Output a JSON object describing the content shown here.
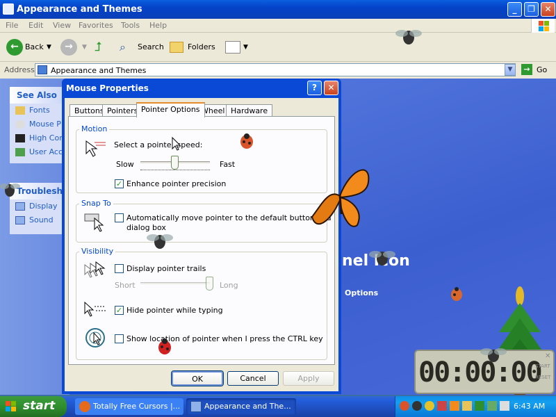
{
  "window": {
    "title": "Appearance and Themes"
  },
  "menu": [
    "File",
    "Edit",
    "View",
    "Favorites",
    "Tools",
    "Help"
  ],
  "toolbar": {
    "back": "Back",
    "search": "Search",
    "folders": "Folders"
  },
  "address": {
    "label": "Address",
    "value": "Appearance and Themes",
    "go": "Go"
  },
  "left": {
    "see_also": {
      "title": "See Also",
      "items": [
        "Fonts",
        "Mouse P",
        "High Con",
        "User Acc"
      ]
    },
    "troubleshoot": {
      "title": "Troublesho",
      "items": [
        "Display",
        "Sound"
      ]
    }
  },
  "content": {
    "big_text": "nel Icon",
    "options_text": "Options"
  },
  "dialog": {
    "title": "Mouse Properties",
    "tabs": [
      "Buttons",
      "Pointers",
      "Pointer Options",
      "Wheel",
      "Hardware"
    ],
    "motion": {
      "label": "Motion",
      "select_speed": "Select a pointer speed:",
      "slow": "Slow",
      "fast": "Fast",
      "enhance": "Enhance pointer precision",
      "enhance_checked": true,
      "speed_level": 0.5
    },
    "snap": {
      "label": "Snap To",
      "text1": "Automatically move pointer to the default button in a",
      "text2": "dialog box",
      "checked": false
    },
    "visibility": {
      "label": "Visibility",
      "trails": "Display pointer trails",
      "short": "Short",
      "long": "Long",
      "trails_checked": false,
      "trail_level": 1.0,
      "hide": "Hide pointer while typing",
      "hide_checked": true,
      "show_loc": "Show location of pointer when I press the CTRL key",
      "show_checked": false
    },
    "buttons": {
      "ok": "OK",
      "cancel": "Cancel",
      "apply": "Apply"
    }
  },
  "clock": {
    "display": "00:00:00",
    "side_top": "START",
    "side_bottom": "RESET"
  },
  "taskbar": {
    "start": "start",
    "tasks": [
      "Totally Free Cursors |...",
      "Appearance and The..."
    ],
    "time": "6:43 AM"
  },
  "colors": {
    "title_blue": "#0a49d6",
    "taskbar_blue": "#245edb",
    "start_green": "#2f8f2f",
    "tray_blue": "#139ff0"
  }
}
